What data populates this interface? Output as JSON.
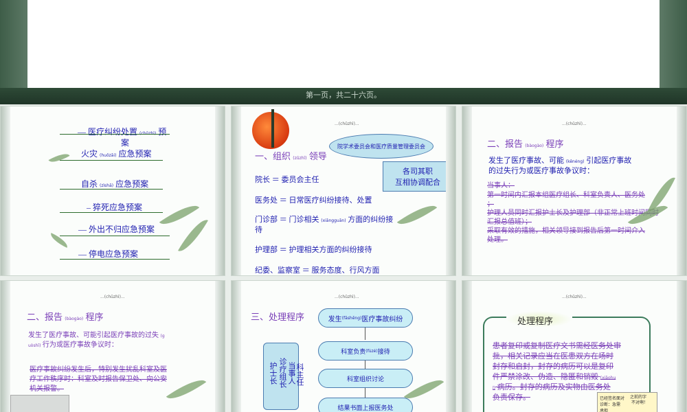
{
  "page_label": "第一页，共二十六页。",
  "slide2": {
    "items": [
      "— 医疗纠纷处置 ",
      "(chǔzhì)",
      " 预",
      "案",
      "火灾 ",
      "(huǒzāi)",
      " 应急预案",
      "自杀 ",
      "(zìshā)",
      " 应急预案",
      "– 猝死应急预案",
      "— 外出不归应急预案",
      "— 停电应急预案"
    ]
  },
  "slide3": {
    "top_small": "...(chǔzhì)...",
    "heading": [
      "一、组织 ",
      "(zǔzhī)",
      " 领导"
    ],
    "ellipse": "院学术委员会和医疗质量管理委员会",
    "box": [
      "各司其职",
      "互相协调配合"
    ],
    "lines": [
      "院长 ＝ 委员会主任",
      "医务处 ＝ 日常医疗纠纷接待、处置",
      "门诊部 ＝ 门诊相关 ",
      "(xiāngguān)",
      " 方面的纠纷接",
      "待",
      "护理部 ＝ 护理相关方面的纠纷接待",
      "纪委、监察室 ＝ 服务态度、行风方面"
    ]
  },
  "slide4": {
    "top_small": "...(chǔzhì)...",
    "heading": [
      "二、报告 ",
      "(bàogào)",
      " 程序"
    ],
    "intro": [
      "发生了医疗事故、可能 ",
      "(kěnéng)",
      " 引起医疗事故",
      "的过失行为或医疗事故争议时："
    ],
    "lines": [
      "当事人：",
      "第一时间内汇报本组医疗组长、科室负责人、医务处",
      "；",
      "护理人员同时汇报护士长及护理部（非正常上班时间同时",
      "汇报总值班）；",
      "采取有效的措施，相关领导接到报告后第一时间介入",
      "处理。"
    ]
  },
  "slide5": {
    "top_small": "...(chǔzhì)...",
    "heading": [
      "二、报告 ",
      "(bàogào)",
      " 程序"
    ],
    "intro": [
      "发生了医疗事故、可能引起医疗事故的过失 ",
      "(g",
      "uòshī)",
      " 行为或医疗事故争议时："
    ],
    "lines": [
      "医疗事故纠纷发生后，特别发生扰乱科室及医",
      "疗工作秩序时：科室及时报告保卫处、向公安",
      "机关报警。"
    ]
  },
  "slide6": {
    "top_small": "...(chǔzhì)...",
    "heading": "三、处理程序",
    "steps": [
      "发生 ",
      "(fāshēng)",
      " 医疗事故纠纷",
      "科室负责 ",
      "(fùzé)",
      " 接待",
      "科室组织讨论",
      "结果书面上报医务处"
    ],
    "scroll": [
      "护士长",
      "诊疗组长",
      "当事人",
      "科主任"
    ]
  },
  "slide7": {
    "top_small": "...(chǔzhì)...",
    "heading": "处理程序",
    "lines": [
      "患者复印或复制医疗文书需经医务处审",
      "批，相关记录应当在医患双方在场时",
      "封存和启封，封存的病历可以是复印",
      "件严禁涂改、伪造、隐匿和销毁 ",
      "(xiāohu",
      "ǐ)",
      " 病历。封存的病历及实物由医务处",
      "负责保存。"
    ],
    "note": [
      "之前的字",
      "不对啊！",
      "已经签名面对",
      "诊断：急需",
      "承担"
    ]
  }
}
